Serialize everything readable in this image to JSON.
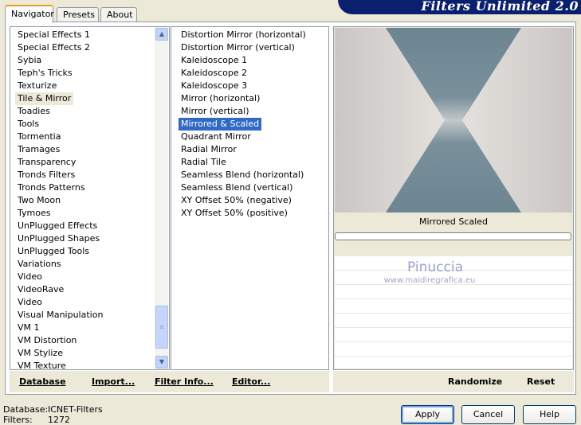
{
  "tabs": [
    "Navigator",
    "Presets",
    "About"
  ],
  "header_title": "Filters Unlimited 2.0",
  "categories": [
    "Special Effects 1",
    "Special Effects 2",
    "Sybia",
    "Teph's Tricks",
    "Texturize",
    "Tile & Mirror",
    "Toadies",
    "Tools",
    "Tormentia",
    "Tramages",
    "Transparency",
    "Tronds Filters",
    "Tronds Patterns",
    "Two Moon",
    "Tymoes",
    "UnPlugged Effects",
    "UnPlugged Shapes",
    "UnPlugged Tools",
    "Variations",
    "Video",
    "VideoRave",
    "Video",
    "Visual Manipulation",
    "VM 1",
    "VM Distortion",
    "VM Stylize",
    "VM Texture"
  ],
  "filters": [
    "Distortion Mirror (horizontal)",
    "Distortion Mirror (vertical)",
    "Kaleidoscope 1",
    "Kaleidoscope 2",
    "Kaleidoscope 3",
    "Mirror (horizontal)",
    "Mirror (vertical)",
    "Mirrored & Scaled",
    "Quadrant Mirror",
    "Radial Mirror",
    "Radial Tile",
    "Seamless Blend (horizontal)",
    "Seamless Blend (vertical)",
    "XY Offset 50% (negative)",
    "XY Offset 50% (positive)"
  ],
  "preview": {
    "filter_name": "Mirrored  Scaled",
    "watermark_name": "Pinuccia",
    "watermark_url": "www.maidiregrafica.eu"
  },
  "actions_left": {
    "database": "Database",
    "import": "Import...",
    "filter_info": "Filter Info...",
    "editor": "Editor..."
  },
  "actions_right": {
    "randomize": "Randomize",
    "reset": "Reset"
  },
  "footer": {
    "database_label": "Database:",
    "database_value": "ICNET-Filters",
    "filters_label": "Filters:",
    "filters_value": "1272"
  },
  "buttons": {
    "apply": "Apply",
    "cancel": "Cancel",
    "help": "Help"
  },
  "colors": {
    "selection": "#316ac5",
    "banner": "#0a1f6e",
    "preview_tile": "#6b8590"
  }
}
